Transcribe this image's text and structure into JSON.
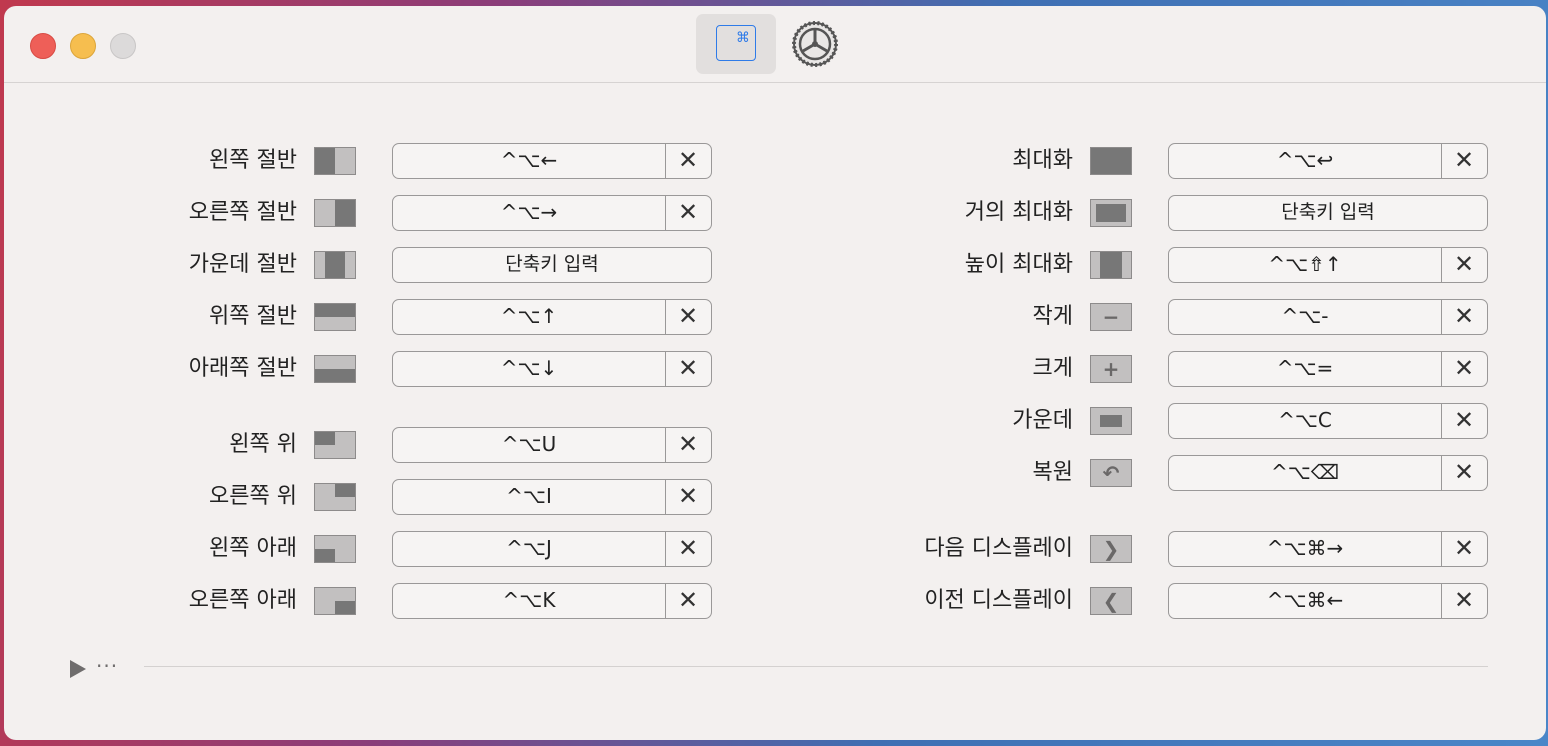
{
  "titlebar": {
    "tabs": [
      {
        "label": "⌘",
        "icon": "command-key-icon"
      },
      {
        "label": "",
        "icon": "gear-icon"
      }
    ]
  },
  "placeholder": "단축키 입력",
  "clear_glyph": "✕",
  "left_rows": [
    {
      "label": "왼쪽 절반",
      "shortcut": "^⌥←"
    },
    {
      "label": "오른쪽 절반",
      "shortcut": "^⌥→"
    },
    {
      "label": "가운데 절반",
      "shortcut": ""
    },
    {
      "label": "위쪽 절반",
      "shortcut": "^⌥↑"
    },
    {
      "label": "아래쪽 절반",
      "shortcut": "^⌥↓"
    },
    {
      "label": "왼쪽 위",
      "shortcut": "^⌥U"
    },
    {
      "label": "오른쪽 위",
      "shortcut": "^⌥I"
    },
    {
      "label": "왼쪽 아래",
      "shortcut": "^⌥J"
    },
    {
      "label": "오른쪽 아래",
      "shortcut": "^⌥K"
    }
  ],
  "right_rows": [
    {
      "label": "최대화",
      "shortcut": "^⌥↩"
    },
    {
      "label": "거의 최대화",
      "shortcut": ""
    },
    {
      "label": "높이 최대화",
      "shortcut": "^⌥⇮↑"
    },
    {
      "label": "작게",
      "shortcut": "^⌥-"
    },
    {
      "label": "크게",
      "shortcut": "^⌥="
    },
    {
      "label": "가운데",
      "shortcut": "^⌥C"
    },
    {
      "label": "복원",
      "shortcut": "^⌥⌫"
    },
    {
      "label": "다음 디스플레이",
      "shortcut": "^⌥⌘→"
    },
    {
      "label": "이전 디스플레이",
      "shortcut": "^⌥⌘←"
    }
  ],
  "footer": {
    "more_label": "···"
  }
}
